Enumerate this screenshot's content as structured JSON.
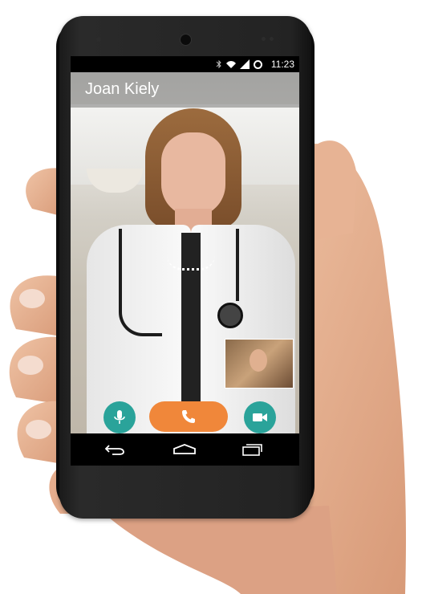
{
  "status_bar": {
    "time": "11:23",
    "icons": [
      "bluetooth-icon",
      "wifi-icon",
      "signal-icon",
      "battery-icon"
    ]
  },
  "call": {
    "caller_name": "Joan Kiely"
  },
  "controls": {
    "mute": "mic-icon",
    "end_call": "phone-icon",
    "video": "video-camera-icon"
  },
  "nav_bar": {
    "buttons": [
      "back-icon",
      "home-icon",
      "recent-apps-icon"
    ]
  },
  "colors": {
    "accent_teal": "#2aa39a",
    "call_orange": "#f0873a"
  }
}
